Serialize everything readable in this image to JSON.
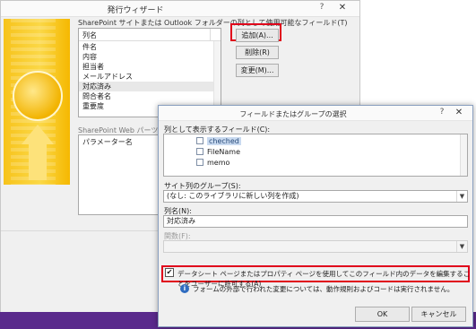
{
  "wizard": {
    "title": "発行ウィザード",
    "help_glyph": "?",
    "close_glyph": "✕",
    "fields_label": "SharePoint サイトまたは Outlook フォルダーの列として使用可能なフィールド(T)",
    "fields_header": "列名",
    "fields": [
      "件名",
      "内容",
      "担当者",
      "メールアドレス",
      "対応済み",
      "問合者名",
      "重要度"
    ],
    "add_button": "追加(A)...",
    "delete_button": "削除(R)",
    "change_button": "変更(M)...",
    "webparts_label": "SharePoint Web パーツの",
    "params_header": "パラメーター名"
  },
  "dialog": {
    "title": "フィールドまたはグループの選択",
    "help_glyph": "?",
    "close_glyph": "✕",
    "columns_label": "列として表示するフィールド(C):",
    "columns": [
      {
        "label": "cheched",
        "selected": true
      },
      {
        "label": "FileName",
        "selected": false
      },
      {
        "label": "memo",
        "selected": false
      }
    ],
    "group_label": "サイト列のグループ(S):",
    "group_value": "(なし: このライブラリに新しい列を作成)",
    "name_label": "列名(N):",
    "name_value": "対応済み",
    "function_label": "関数(F):",
    "function_value": "",
    "allow_checked": true,
    "allow_label": "データシート ページまたはプロパティ ページを使用してこのフィールド内のデータを編集することをユーザーに許可する(A)",
    "info_text": "フォームの外部で行われた変更については、動作規則およびコードは実行されません。",
    "ok_button": "OK",
    "cancel_button": "キャンセル"
  },
  "colors": {
    "highlight": "#e0001b",
    "taskbar": "#5a2a8c",
    "selection": "#c9daf0"
  }
}
